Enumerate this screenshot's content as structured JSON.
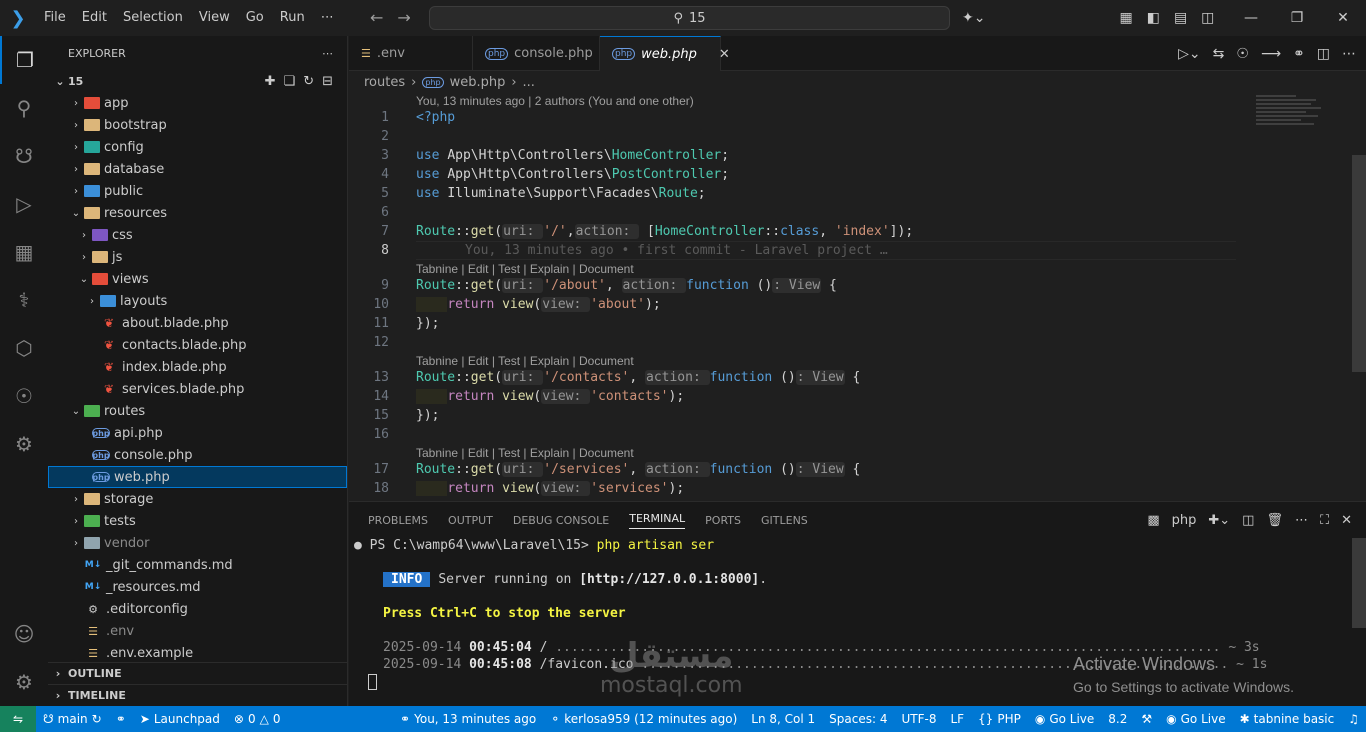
{
  "titlebar": {
    "menu": [
      "File",
      "Edit",
      "Selection",
      "View",
      "Go",
      "Run",
      "⋯"
    ],
    "search": "15"
  },
  "sidebar": {
    "title": "EXPLORER",
    "root": "15",
    "tree": [
      {
        "label": "app",
        "depth": 0,
        "kind": "fold-red",
        "chev": "›"
      },
      {
        "label": "bootstrap",
        "depth": 0,
        "kind": "folder",
        "chev": "›"
      },
      {
        "label": "config",
        "depth": 0,
        "kind": "fold-teal",
        "chev": "›"
      },
      {
        "label": "database",
        "depth": 0,
        "kind": "folder",
        "chev": "›"
      },
      {
        "label": "public",
        "depth": 0,
        "kind": "fold-blue",
        "chev": "›"
      },
      {
        "label": "resources",
        "depth": 0,
        "kind": "folder",
        "chev": "⌄"
      },
      {
        "label": "css",
        "depth": 1,
        "kind": "fold-purple",
        "chev": "›"
      },
      {
        "label": "js",
        "depth": 1,
        "kind": "folder",
        "chev": "›"
      },
      {
        "label": "views",
        "depth": 1,
        "kind": "fold-red",
        "chev": "⌄"
      },
      {
        "label": "layouts",
        "depth": 2,
        "kind": "fold-blue",
        "chev": "›"
      },
      {
        "label": "about.blade.php",
        "depth": 2,
        "kind": "blade",
        "chev": ""
      },
      {
        "label": "contacts.blade.php",
        "depth": 2,
        "kind": "blade",
        "chev": ""
      },
      {
        "label": "index.blade.php",
        "depth": 2,
        "kind": "blade",
        "chev": ""
      },
      {
        "label": "services.blade.php",
        "depth": 2,
        "kind": "blade",
        "chev": ""
      },
      {
        "label": "routes",
        "depth": 0,
        "kind": "fold-green",
        "chev": "⌄"
      },
      {
        "label": "api.php",
        "depth": 1,
        "kind": "php",
        "chev": ""
      },
      {
        "label": "console.php",
        "depth": 1,
        "kind": "php",
        "chev": ""
      },
      {
        "label": "web.php",
        "depth": 1,
        "kind": "php",
        "chev": "",
        "selected": true
      },
      {
        "label": "storage",
        "depth": 0,
        "kind": "folder",
        "chev": "›"
      },
      {
        "label": "tests",
        "depth": 0,
        "kind": "fold-green",
        "chev": "›"
      },
      {
        "label": "vendor",
        "depth": 0,
        "kind": "fold-grey",
        "chev": "›",
        "dim": true
      },
      {
        "label": "_git_commands.md",
        "depth": 0,
        "kind": "md",
        "chev": ""
      },
      {
        "label": "_resources.md",
        "depth": 0,
        "kind": "md",
        "chev": ""
      },
      {
        "label": ".editorconfig",
        "depth": 0,
        "kind": "cfg",
        "chev": ""
      },
      {
        "label": ".env",
        "depth": 0,
        "kind": "env",
        "chev": "",
        "dim": true
      },
      {
        "label": ".env.example",
        "depth": 0,
        "kind": "env",
        "chev": ""
      }
    ],
    "outline": "OUTLINE",
    "timeline": "TIMELINE"
  },
  "tabs": [
    {
      "label": ".env",
      "active": false
    },
    {
      "label": "console.php",
      "active": false
    },
    {
      "label": "web.php",
      "active": true
    }
  ],
  "breadcrumb": [
    "routes",
    "web.php",
    "..."
  ],
  "editor": {
    "blame_header": "You, 13 minutes ago | 2 authors (You and one other)",
    "codelens": "Tabnine | Edit | Test | Explain | Document",
    "ghost_blame": "You, 13 minutes ago • first commit - Laravel project …",
    "line_numbers": [
      "1",
      "2",
      "3",
      "4",
      "5",
      "6",
      "7",
      "8",
      "9",
      "10",
      "11",
      "12",
      "13",
      "14",
      "15",
      "16",
      "17",
      "18"
    ],
    "use_lines": [
      {
        "ns": "App\\Http\\Controllers\\",
        "cls": "HomeController"
      },
      {
        "ns": "App\\Http\\Controllers\\",
        "cls": "PostController"
      },
      {
        "ns": "Illuminate\\Support\\Facades\\",
        "cls": "Route"
      }
    ],
    "routes": [
      {
        "uri": "'/about'",
        "view": "'about'"
      },
      {
        "uri": "'/contacts'",
        "view": "'contacts'"
      },
      {
        "uri": "'/services'",
        "view": "'services'"
      }
    ]
  },
  "panel": {
    "tabs": [
      "PROBLEMS",
      "OUTPUT",
      "DEBUG CONSOLE",
      "TERMINAL",
      "PORTS",
      "GITLENS"
    ],
    "active_tab": "TERMINAL",
    "shell": "php",
    "terminal": {
      "prompt": "PS C:\\wamp64\\www\\Laravel\\15>",
      "command": "php artisan ser",
      "info_badge": "INFO",
      "info_text": "Server running on",
      "info_url": "[http://127.0.0.1:8000]",
      "stop_text": "Press Ctrl+C to stop the server",
      "log1_date": "2025-09-14",
      "log1_time": "00:45:04",
      "log1_path": "/",
      "log1_dots": ".....................................................................................",
      "log1_dur": "~ 3s",
      "log2_date": "2025-09-14",
      "log2_time": "00:45:08",
      "log2_path": "/favicon.ico",
      "log2_dots": "...........................................................................",
      "log2_dur": "~ 1s"
    },
    "activate_title": "Activate Windows",
    "activate_sub": "Go to Settings to activate Windows.",
    "watermark_ar": "مستقل",
    "watermark_en": "mostaql.com"
  },
  "statusbar": {
    "branch": "main",
    "launchpad": "Launchpad",
    "problems": "0",
    "warnings": "0",
    "blame": "You, 13 minutes ago",
    "author": "kerlosa959 (12 minutes ago)",
    "position": "Ln 8, Col 1",
    "spaces": "Spaces: 4",
    "encoding": "UTF-8",
    "eol": "LF",
    "language": "PHP",
    "golive1": "Go Live",
    "php_version": "8.2",
    "golive2": "Go Live",
    "tabnine": "tabnine basic"
  },
  "colors": {
    "accent": "#0078d4",
    "statusbar": "#0078d4",
    "remote": "#16825d"
  }
}
